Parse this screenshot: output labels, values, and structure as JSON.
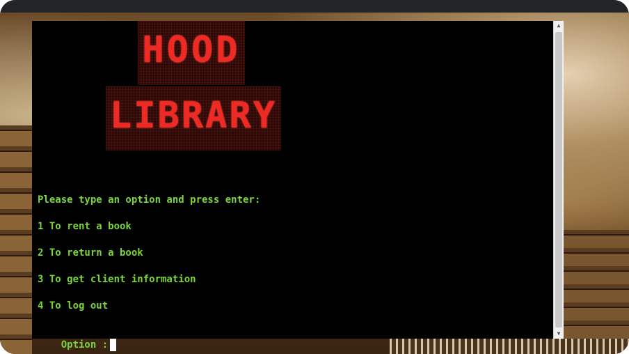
{
  "banner": {
    "line1": "HOOD",
    "line2": "LIBRARY"
  },
  "menu": {
    "prompt": "Please type an option and press enter:",
    "options": [
      "1 To rent a book",
      "2 To return a book",
      "3 To get client information",
      "4 To log out"
    ],
    "input_label": "Option :",
    "input_value": ""
  },
  "colors": {
    "terminal_bg": "#000000",
    "text": "#7ad636",
    "banner_text": "#ee2a24",
    "cursor": "#ffffff"
  },
  "icons": {
    "scroll_up": "scroll-up-arrow-icon",
    "scroll_down": "scroll-down-arrow-icon"
  }
}
